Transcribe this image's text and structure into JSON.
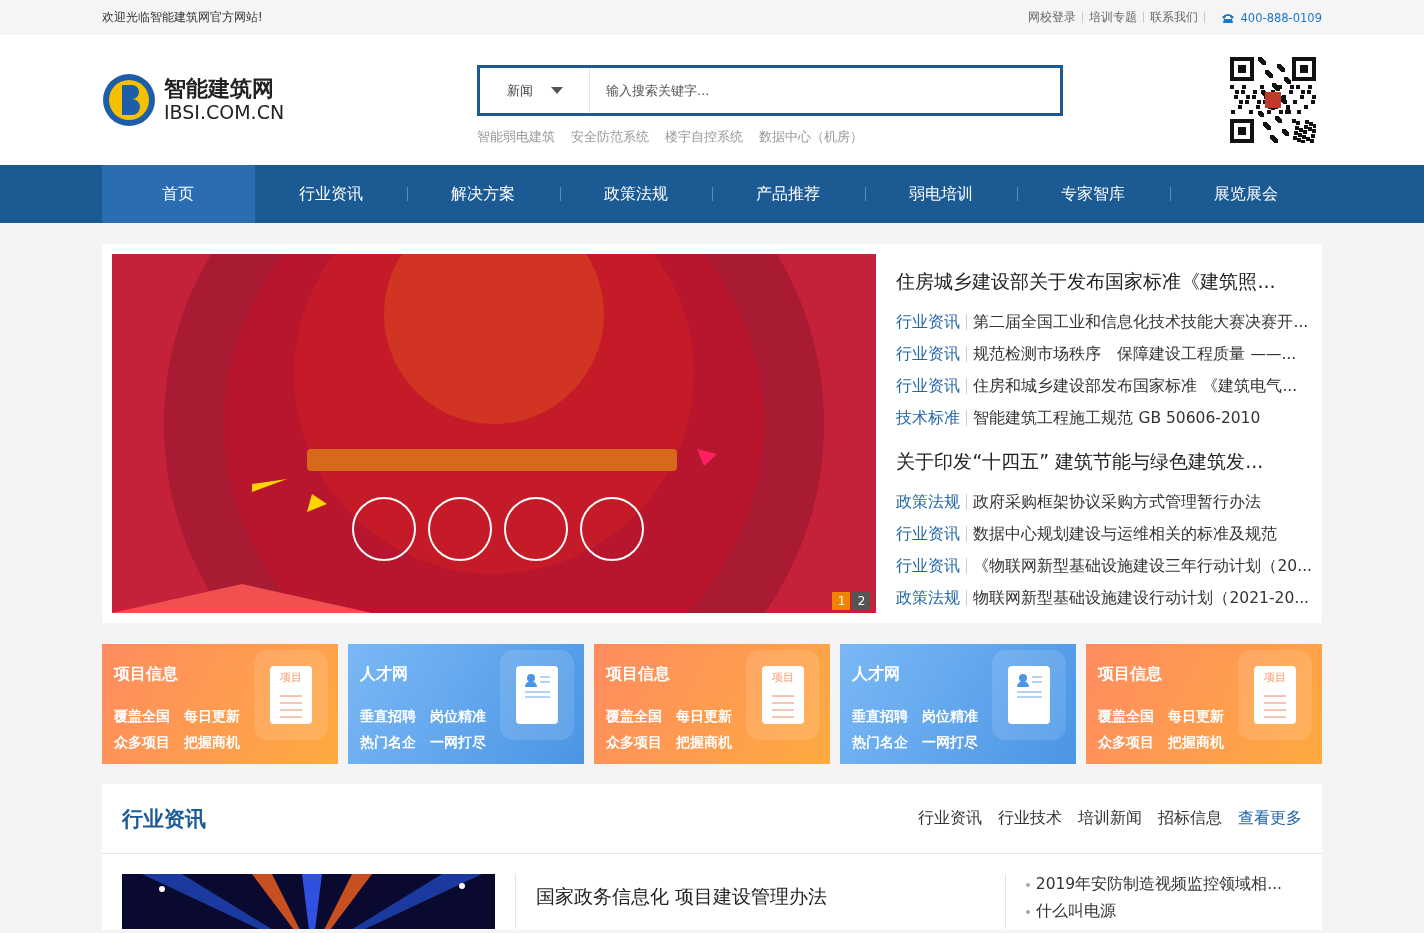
{
  "top_bar": {
    "welcome": "欢迎光临智能建筑网官方网站!",
    "links": [
      "网校登录",
      "培训专题",
      "联系我们"
    ],
    "phone": "400-888-0109"
  },
  "header": {
    "logo": {
      "name": "智能建筑网",
      "domain": "IBSI.COM.CN"
    },
    "search": {
      "category": "新闻",
      "placeholder": "输入搜索关键字..."
    },
    "hot_keywords": [
      "智能弱电建筑",
      "安全防范系统",
      "楼宇自控系统",
      "数据中心（机房）"
    ]
  },
  "nav": [
    {
      "label": "首页",
      "selected": true
    },
    {
      "label": "行业资讯",
      "selected": false
    },
    {
      "label": "解决方案",
      "selected": false
    },
    {
      "label": "政策法规",
      "selected": false
    },
    {
      "label": "产品推荐",
      "selected": false
    },
    {
      "label": "弱电培训",
      "selected": false
    },
    {
      "label": "专家智库",
      "selected": false
    },
    {
      "label": "展览展会",
      "selected": false
    }
  ],
  "slider": {
    "kind": "picture",
    "pages": [
      {
        "label": "1",
        "selected": true
      },
      {
        "label": "2",
        "selected": false
      }
    ]
  },
  "headlines": [
    {
      "title": "住房城乡建设部关于发布国家标准《建筑照...",
      "items": [
        {
          "tag": "行业资讯",
          "text": "第二届全国工业和信息化技术技能大赛决赛开..."
        },
        {
          "tag": "行业资讯",
          "text": "规范检测市场秩序　保障建设工程质量 ——..."
        },
        {
          "tag": "行业资讯",
          "text": "住房和城乡建设部发布国家标准 《建筑电气..."
        },
        {
          "tag": "技术标准",
          "text": "智能建筑工程施工规范 GB 50606-2010"
        }
      ]
    },
    {
      "title": "关于印发“十四五” 建筑节能与绿色建筑发...",
      "items": [
        {
          "tag": "政策法规",
          "text": "政府采购框架协议采购方式管理暂行办法"
        },
        {
          "tag": "行业资讯",
          "text": "数据中心规划建设与运维相关的标准及规范"
        },
        {
          "tag": "行业资讯",
          "text": "《物联网新型基础设施建设三年行动计划（20..."
        },
        {
          "tag": "政策法规",
          "text": "物联网新型基础设施建设行动计划（2021-20..."
        }
      ]
    }
  ],
  "promo_cards": [
    {
      "kind": "project",
      "title": "项目信息",
      "lines": [
        "覆盖全国　每日更新",
        "众多项目　把握商机"
      ],
      "badge": "项目"
    },
    {
      "kind": "talent",
      "title": "人才网",
      "lines": [
        "垂直招聘　岗位精准",
        "热门名企　一网打尽"
      ]
    },
    {
      "kind": "project",
      "title": "项目信息",
      "lines": [
        "覆盖全国　每日更新",
        "众多项目　把握商机"
      ],
      "badge": "项目"
    },
    {
      "kind": "talent",
      "title": "人才网",
      "lines": [
        "垂直招聘　岗位精准",
        "热门名企　一网打尽"
      ]
    },
    {
      "kind": "project",
      "title": "项目信息",
      "lines": [
        "覆盖全国　每日更新",
        "众多项目　把握商机"
      ],
      "badge": "项目"
    }
  ],
  "news_section": {
    "title": "行业资讯",
    "tabs": [
      "行业资讯",
      "行业技术",
      "培训新闻",
      "招标信息"
    ],
    "more": "查看更多",
    "image": {
      "kind": "picture"
    },
    "lead_title": "国家政务信息化 项目建设管理办法",
    "side_list": [
      "2019年安防制造视频监控领域相...",
      "什么叫电源"
    ]
  }
}
